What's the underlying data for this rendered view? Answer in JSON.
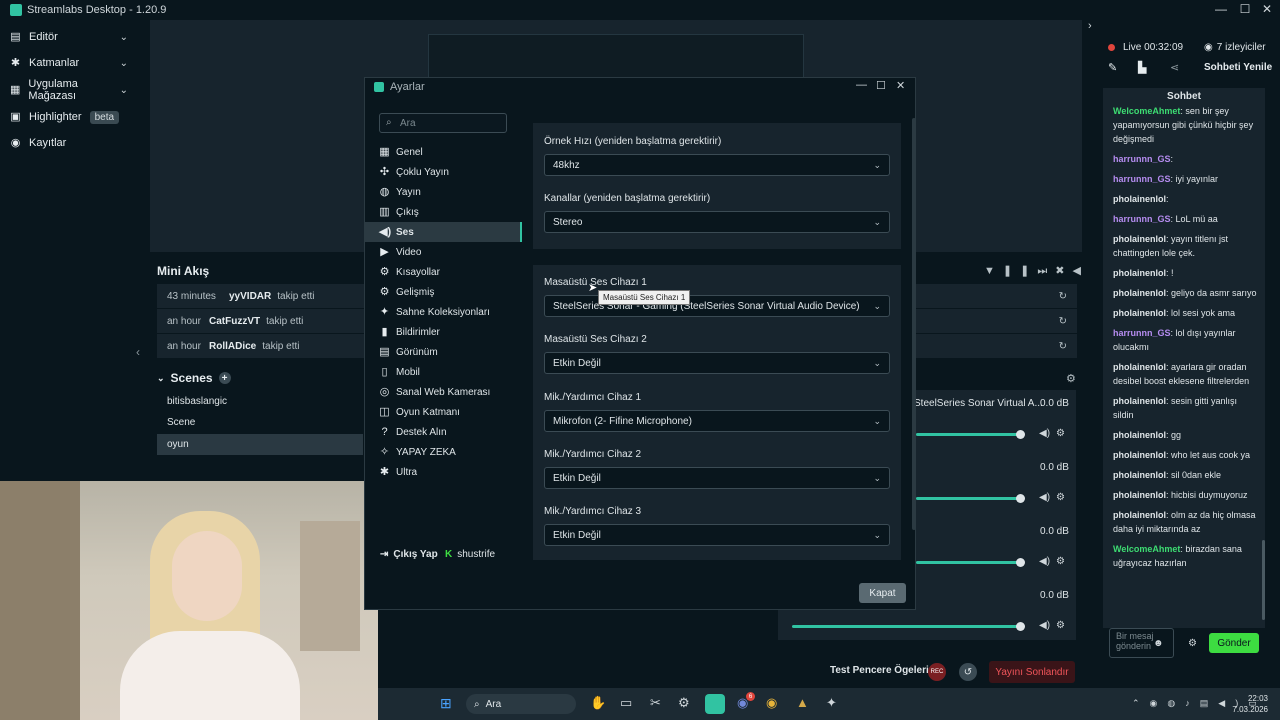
{
  "app": {
    "title": "Streamlabs Desktop - 1.20.9"
  },
  "sidebar": {
    "items": [
      {
        "label": "Editör",
        "icon": "editor-icon"
      },
      {
        "label": "Katmanlar",
        "icon": "layers-icon"
      },
      {
        "label": "Uygulama Mağazası",
        "icon": "store-icon"
      },
      {
        "label": "Highlighter",
        "icon": "highlighter-icon",
        "badge": "beta"
      },
      {
        "label": "Kayıtlar",
        "icon": "recordings-icon"
      }
    ]
  },
  "activity": {
    "title": "Mini Akış",
    "rows": [
      {
        "time": "43 minutes",
        "user": "yyVIDAR",
        "action": "takip etti"
      },
      {
        "time": "an hour",
        "user": "CatFuzzVT",
        "action": "takip etti"
      },
      {
        "time": "an hour",
        "user": "RollADice",
        "action": "takip etti"
      }
    ]
  },
  "scenes": {
    "title": "Scenes",
    "items": [
      "bitisbaslangic",
      "Scene",
      "oyun"
    ],
    "selected": "oyun"
  },
  "mixer": {
    "sources": [
      {
        "name": "SteelSeries Sonar Virtual A...",
        "db": "0.0 dB"
      },
      {
        "name": "",
        "db": "0.0 dB"
      },
      {
        "name": "",
        "db": "0.0 dB"
      },
      {
        "name": "",
        "db": "0.0 dB"
      }
    ]
  },
  "bottom": {
    "test_label": "Test Pencere Ögeleri",
    "rec_label": "REC",
    "end_stream": "Yayını Sonlandır"
  },
  "dialog": {
    "title": "Ayarlar",
    "search_placeholder": "Ara",
    "items": [
      "Genel",
      "Çoklu Yayın",
      "Yayın",
      "Çıkış",
      "Ses",
      "Video",
      "Kısayollar",
      "Gelişmiş",
      "Sahne Koleksiyonları",
      "Bildirimler",
      "Görünüm",
      "Mobil",
      "Sanal Web Kamerası",
      "Oyun Katmanı",
      "Destek Alın",
      "YAPAY ZEKA",
      "Ultra"
    ],
    "active": "Ses",
    "logout": "Çıkış Yap",
    "user": "shustrife",
    "close": "Kapat",
    "fields": [
      {
        "label": "Örnek Hızı (yeniden başlatma gerektirir)",
        "value": "48khz"
      },
      {
        "label": "Kanallar (yeniden başlatma gerektirir)",
        "value": "Stereo"
      },
      {
        "label": "Masaüstü Ses Cihazı 1",
        "value": "SteelSeries Sonar - Gaming (SteelSeries Sonar Virtual Audio Device)"
      },
      {
        "label": "Masaüstü Ses Cihazı 2",
        "value": "Etkin Değil"
      },
      {
        "label": "Mik./Yardımcı Cihaz 1",
        "value": "Mikrofon (2- Fifine Microphone)"
      },
      {
        "label": "Mik./Yardımcı Cihaz 2",
        "value": "Etkin Değil"
      },
      {
        "label": "Mik./Yardımcı Cihaz 3",
        "value": "Etkin Değil"
      }
    ],
    "tooltip": "Masaüstü Ses Cihazı 1"
  },
  "live": {
    "status": "Live",
    "time": "00:32:09",
    "viewers": "7 izleyiciler",
    "refresh": "Sohbeti Yenile",
    "chat_title": "Sohbet"
  },
  "chat": {
    "messages": [
      {
        "user": "WelcomeAhmet",
        "text": "sen bir şey yapamıyorsun gibi çünkü hiçbir şey değişmedi",
        "color": "#3ddc72"
      },
      {
        "user": "harrunnn_GS",
        "text": "",
        "color": "#b58cf0"
      },
      {
        "user": "harrunnn_GS",
        "text": "iyi yayınlar",
        "color": "#b58cf0"
      },
      {
        "user": "pholainenlol",
        "text": "",
        "color": "#dfe5e8"
      },
      {
        "user": "harrunnn_GS",
        "text": "LoL mü aa",
        "color": "#b58cf0"
      },
      {
        "user": "pholainenlol",
        "text": "yayın titlenı jst chattingden lole çek.",
        "color": "#dfe5e8"
      },
      {
        "user": "pholainenlol",
        "text": "!",
        "color": "#dfe5e8"
      },
      {
        "user": "pholainenlol",
        "text": "geliyo da asmr sarıyo",
        "color": "#dfe5e8"
      },
      {
        "user": "pholainenlol",
        "text": "lol sesi yok ama",
        "color": "#dfe5e8"
      },
      {
        "user": "harrunnn_GS",
        "text": "lol dışı yayınlar olucakmı",
        "color": "#b58cf0"
      },
      {
        "user": "pholainenlol",
        "text": "ayarlara gir oradan desibel boost eklesene filtrelerden",
        "color": "#dfe5e8"
      },
      {
        "user": "pholainenlol",
        "text": "sesin gitti yanlışı sildin",
        "color": "#dfe5e8"
      },
      {
        "user": "pholainenlol",
        "text": "gg",
        "color": "#dfe5e8"
      },
      {
        "user": "pholainenlol",
        "text": "who let aus cook ya",
        "color": "#dfe5e8"
      },
      {
        "user": "pholainenlol",
        "text": "sil 0dan ekle",
        "color": "#dfe5e8"
      },
      {
        "user": "pholainenlol",
        "text": "hicbisi duymuyoruz",
        "color": "#dfe5e8"
      },
      {
        "user": "pholainenlol",
        "text": "olm az da hiç olmasa daha iyi miktarında az",
        "color": "#dfe5e8"
      },
      {
        "user": "WelcomeAhmet",
        "text": "birazdan sana uğrayıcaz hazırlan",
        "color": "#3ddc72"
      }
    ],
    "input_placeholder": "Bir mesaj gönderin",
    "send": "Gönder"
  },
  "taskbar": {
    "search": "Ara",
    "time": "22:03",
    "date": "7.03.2026",
    "discord_badge": "6"
  },
  "colors": {
    "accent": "#31c3a2",
    "live": "#e0453c",
    "send": "#3ddc41"
  }
}
